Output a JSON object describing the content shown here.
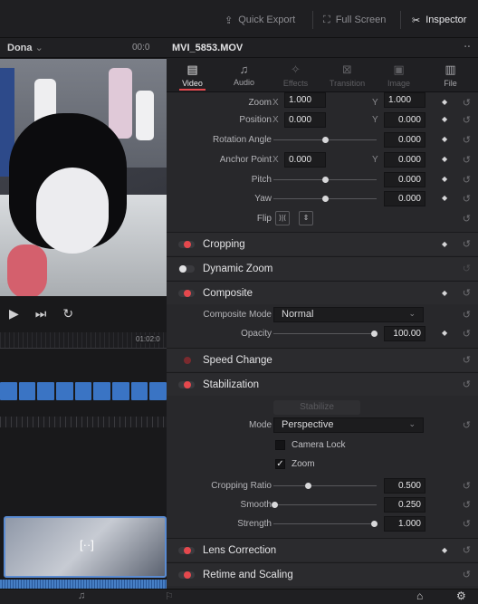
{
  "topbar": {
    "quick_export": "Quick Export",
    "full_screen": "Full Screen",
    "inspector": "Inspector"
  },
  "viewer": {
    "clip_name": "Dona",
    "timecode": "00:0",
    "ruler_time": "01:02:0",
    "thumb_glyph": "[··]"
  },
  "inspector": {
    "clip_title": "MVI_5853.MOV",
    "tabs": [
      "Video",
      "Audio",
      "Effects",
      "Transition",
      "Image",
      "File"
    ],
    "transform": {
      "zoom": {
        "label": "Zoom",
        "x": "1.000",
        "y": "1.000"
      },
      "position": {
        "label": "Position",
        "x": "0.000",
        "y": "0.000"
      },
      "rotation": {
        "label": "Rotation Angle",
        "value": "0.000"
      },
      "anchor": {
        "label": "Anchor Point",
        "x": "0.000",
        "y": "0.000"
      },
      "pitch": {
        "label": "Pitch",
        "value": "0.000"
      },
      "yaw": {
        "label": "Yaw",
        "value": "0.000"
      },
      "flip": {
        "label": "Flip"
      }
    },
    "sections": {
      "cropping": "Cropping",
      "dynamic_zoom": "Dynamic Zoom",
      "composite": "Composite",
      "speed_change": "Speed Change",
      "stabilization": "Stabilization",
      "lens_correction": "Lens Correction",
      "retime": "Retime and Scaling"
    },
    "composite": {
      "mode_label": "Composite Mode",
      "mode_value": "Normal",
      "opacity_label": "Opacity",
      "opacity_value": "100.00"
    },
    "stabilization": {
      "button": "Stabilize",
      "mode_label": "Mode",
      "mode_value": "Perspective",
      "camera_lock": "Camera Lock",
      "zoom": "Zoom",
      "cropping_ratio_label": "Cropping Ratio",
      "cropping_ratio": "0.500",
      "smooth_label": "Smooth",
      "smooth": "0.250",
      "strength_label": "Strength",
      "strength": "1.000"
    },
    "axis_x": "X",
    "axis_y": "Y"
  },
  "colors": {
    "accent": "#e5484d",
    "clip_blue": "#3a74c4",
    "panel": "#28282b"
  }
}
